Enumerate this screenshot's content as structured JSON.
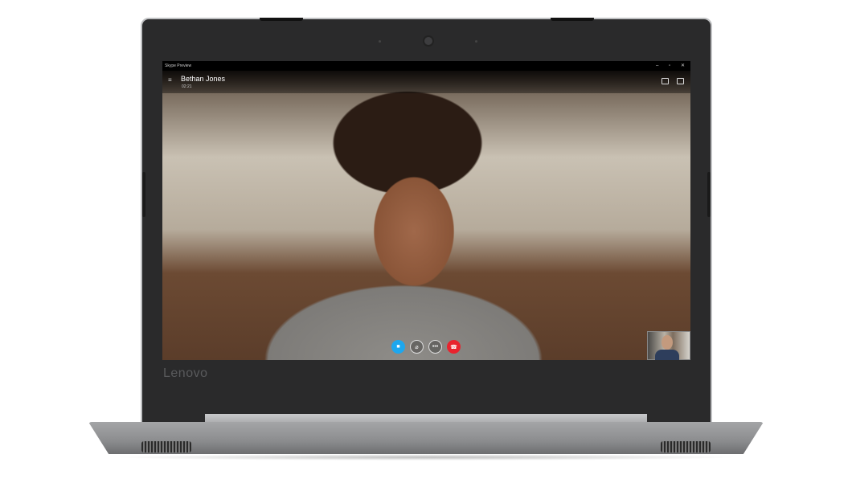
{
  "device": {
    "brand": "Lenovo"
  },
  "window": {
    "title": "Skype Preview",
    "controls": {
      "minimize": "–",
      "maximize": "▫",
      "close": "✕"
    }
  },
  "call": {
    "contact_name": "Bethan Jones",
    "duration": "02:21",
    "buttons": [
      {
        "name": "video-button",
        "icon": "video-camera-icon",
        "color": "#1ea7ee"
      },
      {
        "name": "mute-button",
        "icon": "microphone-muted-icon",
        "color": "rgba(0,0,0,0.25)"
      },
      {
        "name": "more-button",
        "icon": "more-icon",
        "label": "•••",
        "color": "rgba(0,0,0,0.25)"
      },
      {
        "name": "end-call-button",
        "icon": "hang-up-icon",
        "color": "#e8232e"
      }
    ]
  },
  "header_icons": [
    "video-toggle-icon",
    "chat-icon"
  ]
}
